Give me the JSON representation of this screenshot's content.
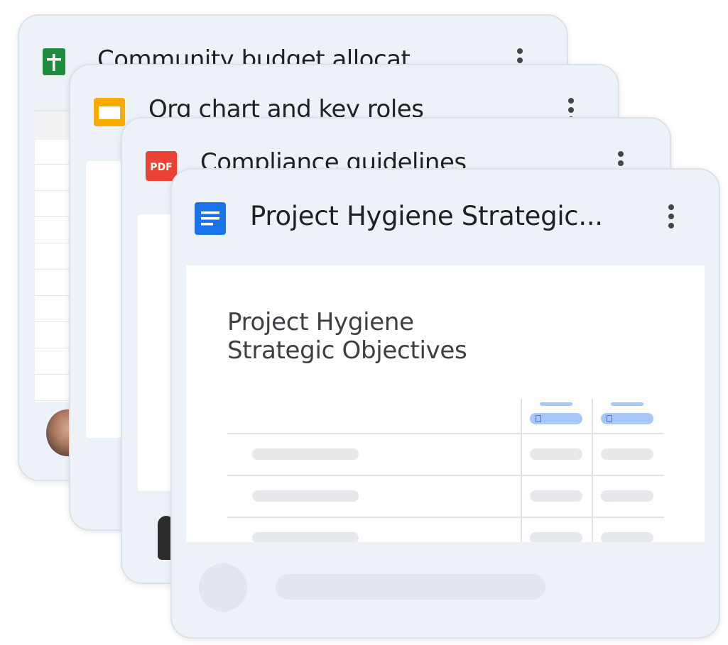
{
  "cards": [
    {
      "title": "Community budget allocat",
      "file_type": "sheets-icon"
    },
    {
      "title": "Org chart and key roles",
      "file_type": "slides-icon"
    },
    {
      "title": "Compliance guidelines",
      "file_type": "pdf-icon",
      "icon_label": "PDF"
    },
    {
      "title": "Project Hygiene Strategic...",
      "file_type": "docs-icon",
      "preview": {
        "heading_line1": "Project Hygiene",
        "heading_line2": "Strategic Objectives"
      }
    }
  ],
  "colors": {
    "sheets": "#1e8e3e",
    "slides": "#f9ab00",
    "pdf": "#ea4335",
    "docs": "#1a73e8",
    "card_bg": "#edf1f8"
  }
}
